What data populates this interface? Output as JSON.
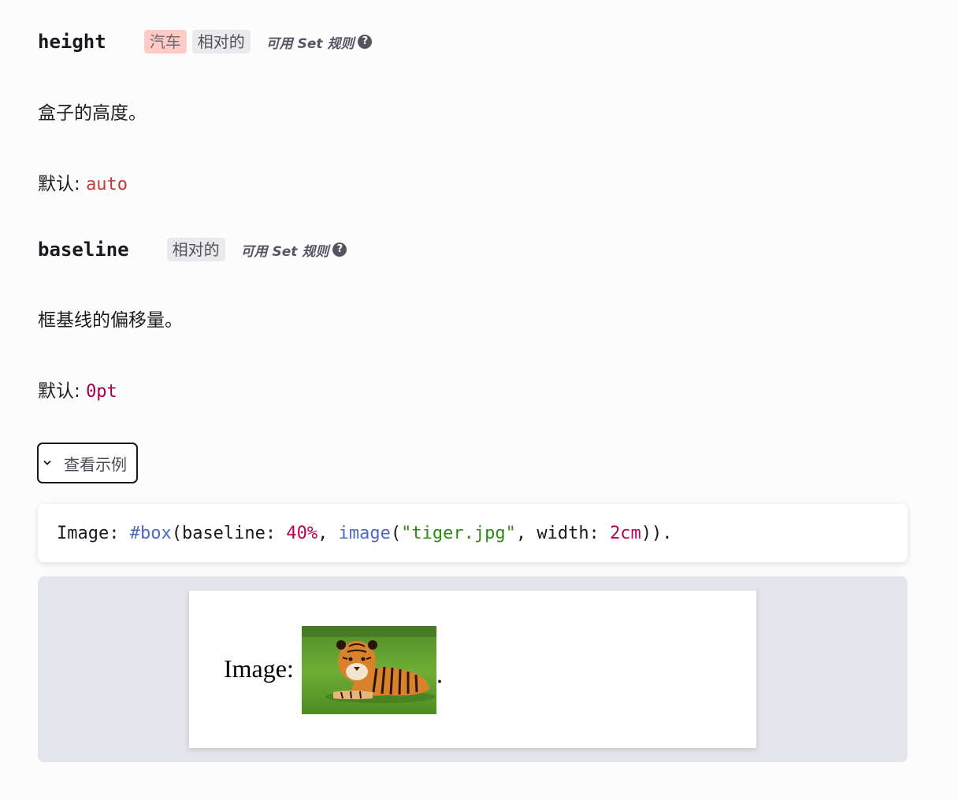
{
  "params": [
    {
      "name": "height",
      "tags": [
        "汽车",
        "相对的"
      ],
      "settable": "可用 Set 规则",
      "help": "?",
      "description": "盒子的高度。",
      "default_label": "默认:",
      "default_value": "auto"
    },
    {
      "name": "baseline",
      "tags": [
        "相对的"
      ],
      "settable": "可用 Set 规则",
      "help": "?",
      "description": "框基线的偏移量。",
      "default_label": "默认:",
      "default_value": "0pt"
    }
  ],
  "example": {
    "toggle_label": "查看示例",
    "code": {
      "t1": "Image: ",
      "t2": "#box",
      "t3": "(baseline: ",
      "t4": "40%",
      "t5": ", ",
      "t6": "image",
      "t7": "(",
      "t8": "\"tiger.jpg\"",
      "t9": ", width: ",
      "t10": "2cm",
      "t11": "))."
    },
    "preview": {
      "text": "Image:",
      "trailing": "."
    }
  },
  "colors": {
    "auto_tag_bg": "#ffcbc4",
    "relative_tag_bg": "#e9eaed",
    "default_auto_color": "#c43a3a",
    "default_pt_color": "#a4004f",
    "code_fn": "#4b69c6",
    "code_number": "#b60157",
    "code_string": "#298e0d"
  }
}
